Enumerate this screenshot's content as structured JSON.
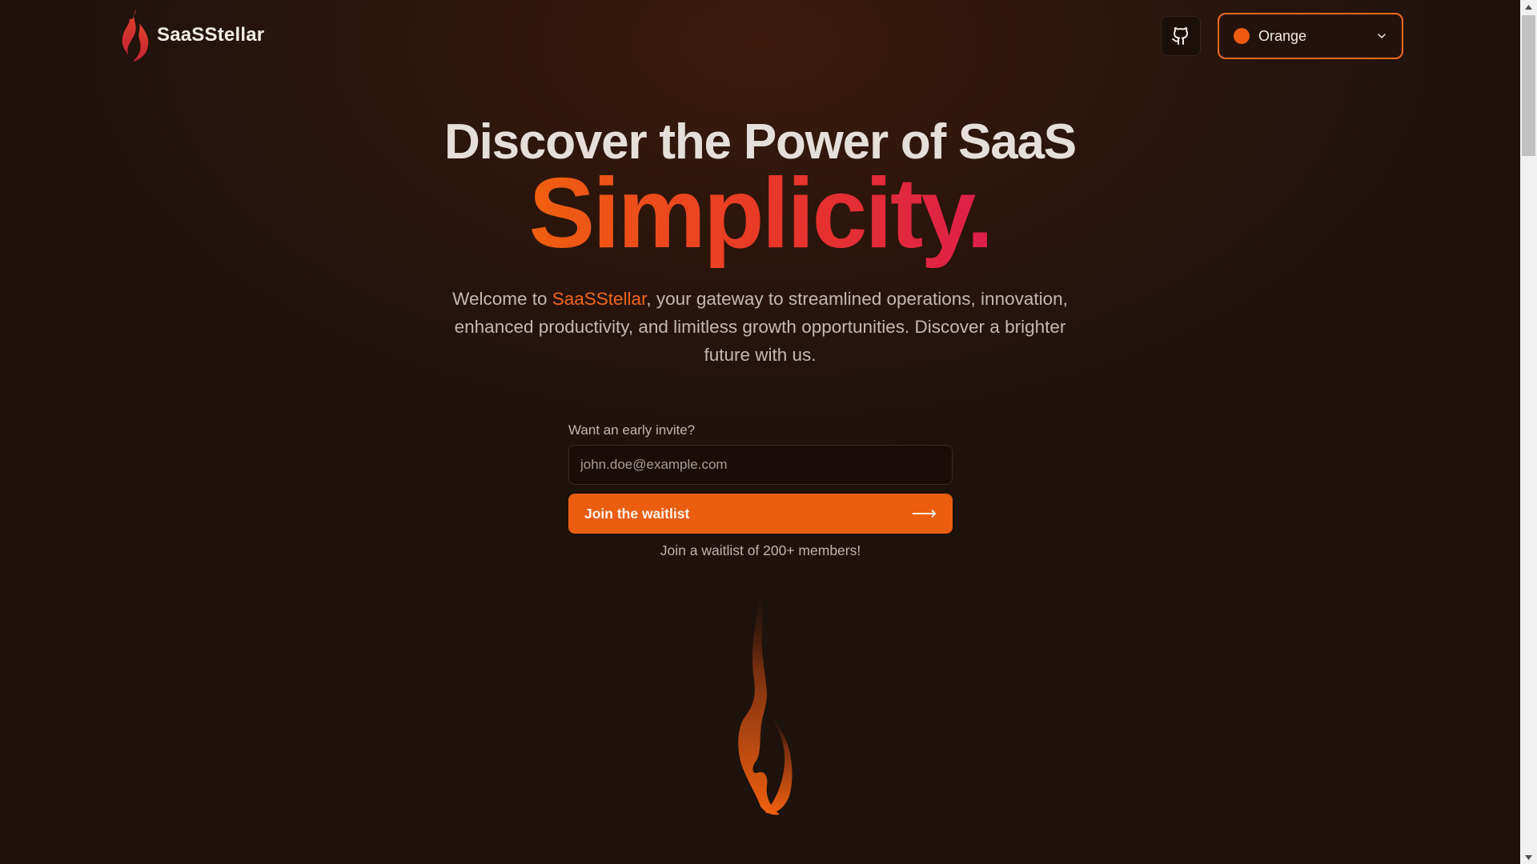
{
  "brand": {
    "name": "SaaSStellar",
    "logo_icon": "flame-icon"
  },
  "header": {
    "github_icon": "github-icon",
    "theme": {
      "selected": "Orange",
      "swatch_color": "#ed5a10"
    }
  },
  "hero": {
    "title": "Discover the Power of SaaS",
    "accent": "Simplicity.",
    "sub_before": "Welcome to ",
    "sub_brand": "SaaSStellar",
    "sub_after": ", your gateway to streamlined operations, innovation, enhanced productivity, and limitless growth opportunities. Discover a brighter future with us."
  },
  "form": {
    "label": "Want an early invite?",
    "email_placeholder": "john.doe@example.com",
    "email_value": "",
    "button_label": "Join the waitlist",
    "button_arrow": "⟶",
    "note": "Join a waitlist of 200+ members!"
  },
  "colors": {
    "accent": "#eb5d0f",
    "accent_gradient_end": "#dc1f4b",
    "background": "#2b150b"
  }
}
